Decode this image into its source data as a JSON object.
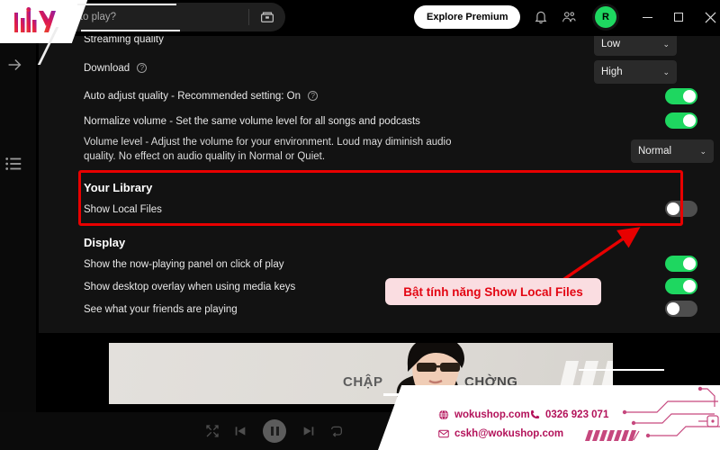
{
  "window": {
    "minimize_label": "–",
    "maximize_label": "▢",
    "close_label": "✕"
  },
  "topbar": {
    "search_value": "nt to play?",
    "search_placeholder": "What do you want to play?",
    "browse_icon": "browse-icon",
    "premium_button": "Explore Premium",
    "bell_icon": "notifications-bell-icon",
    "friends_icon": "friends-activity-icon",
    "avatar_initial": "R"
  },
  "left_rail": {
    "forward_icon": "arrow-right-icon",
    "list_icon": "list-view-icon"
  },
  "settings": {
    "rows": [
      {
        "label": "Streaming quality",
        "help": false,
        "control": "dropdown",
        "value": "Low"
      },
      {
        "label": "Download",
        "help": true,
        "control": "dropdown",
        "value": "High"
      },
      {
        "label": "Auto adjust quality - Recommended setting: On",
        "help": true,
        "control": "toggle",
        "state": "on"
      },
      {
        "label": "Normalize volume - Set the same volume level for all songs and podcasts",
        "help": false,
        "control": "toggle",
        "state": "on"
      },
      {
        "label": "Volume level - Adjust the volume for your environment. Loud may diminish audio quality. No effect on audio quality in Normal or Quiet.",
        "help": false,
        "control": "dropdown",
        "value": "Normal"
      }
    ],
    "library_section": {
      "heading": "Your Library",
      "row_label": "Show Local Files",
      "toggle_state": "off",
      "highlight_color": "#e80000"
    },
    "display_section": {
      "heading": "Display",
      "rows": [
        {
          "label": "Show the now-playing panel on click of play",
          "state": "on"
        },
        {
          "label": "Show desktop overlay when using media keys",
          "state": "on"
        },
        {
          "label": "See what your friends are playing",
          "state": "off"
        }
      ]
    }
  },
  "annotation": {
    "text": "Bật tính năng Show Local Files",
    "text_color": "#e30613",
    "background_color": "#fadde1",
    "arrow_color": "#e80000"
  },
  "banner": {
    "title_part1": "CHẬP",
    "title_part2": "CHỜNG"
  },
  "player": {
    "shuffle_icon": "shuffle-icon",
    "previous_icon": "skip-previous-icon",
    "play_pause_icon": "pause-icon",
    "next_icon": "skip-next-icon",
    "repeat_icon": "repeat-icon"
  },
  "watermark": {
    "logo_icon": "wokushop-logo",
    "website": "wokushop.com",
    "phone": "0326 923 071",
    "email": "cskh@wokushop.com",
    "globe_icon": "globe-icon",
    "phone_icon": "phone-icon",
    "mail_icon": "mail-icon",
    "brand_color": "#b3125a"
  }
}
